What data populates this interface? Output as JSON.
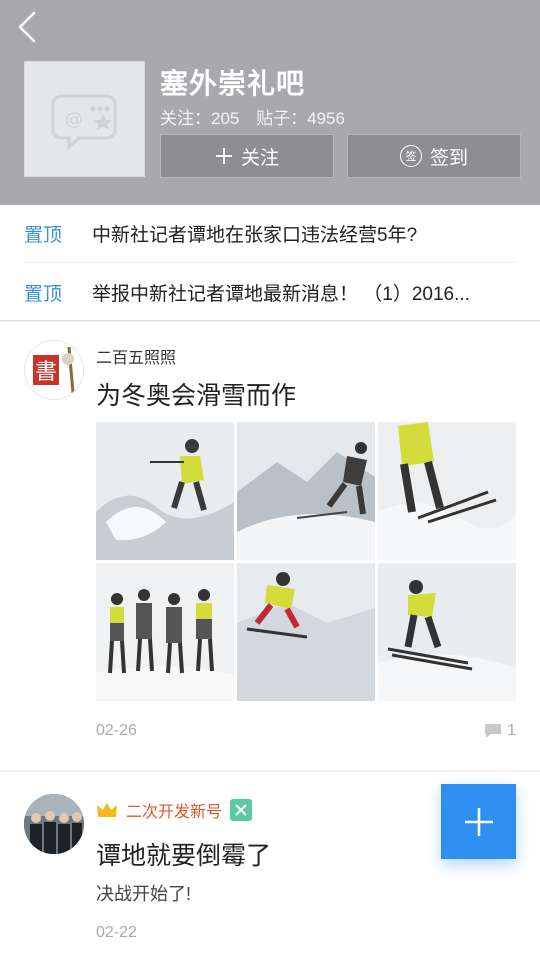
{
  "header": {
    "forum_name": "塞外崇礼吧",
    "followers_label": "关注：205",
    "posts_label": "贴子：4956",
    "follow_label": "关注",
    "sign_label": "签到",
    "sign_icon_char": "签"
  },
  "pinned": [
    {
      "tag": "置顶",
      "text": "中新社记者谭地在张家口违法经营5年?"
    },
    {
      "tag": "置顶",
      "text": "举报中新社记者谭地最新消息！ （1）2016..."
    }
  ],
  "posts": [
    {
      "user": "二百五照照",
      "title": "为冬奥会滑雪而作",
      "date": "02-26",
      "comments": "1"
    },
    {
      "user": "二次开发新号",
      "title": "谭地就要倒霉了",
      "body": "决战开始了!",
      "date": "02-22"
    }
  ],
  "colors": {
    "header_bg": "#a9a8ad",
    "accent_blue": "#2f8ff0",
    "pin_blue": "#3b8fe0",
    "username_orange": "#e0562c"
  },
  "icons": [
    "back-icon",
    "forum-placeholder-icon",
    "plus-icon",
    "sign-icon",
    "comment-icon",
    "crown-icon",
    "badge-icon",
    "fab-plus-icon"
  ]
}
